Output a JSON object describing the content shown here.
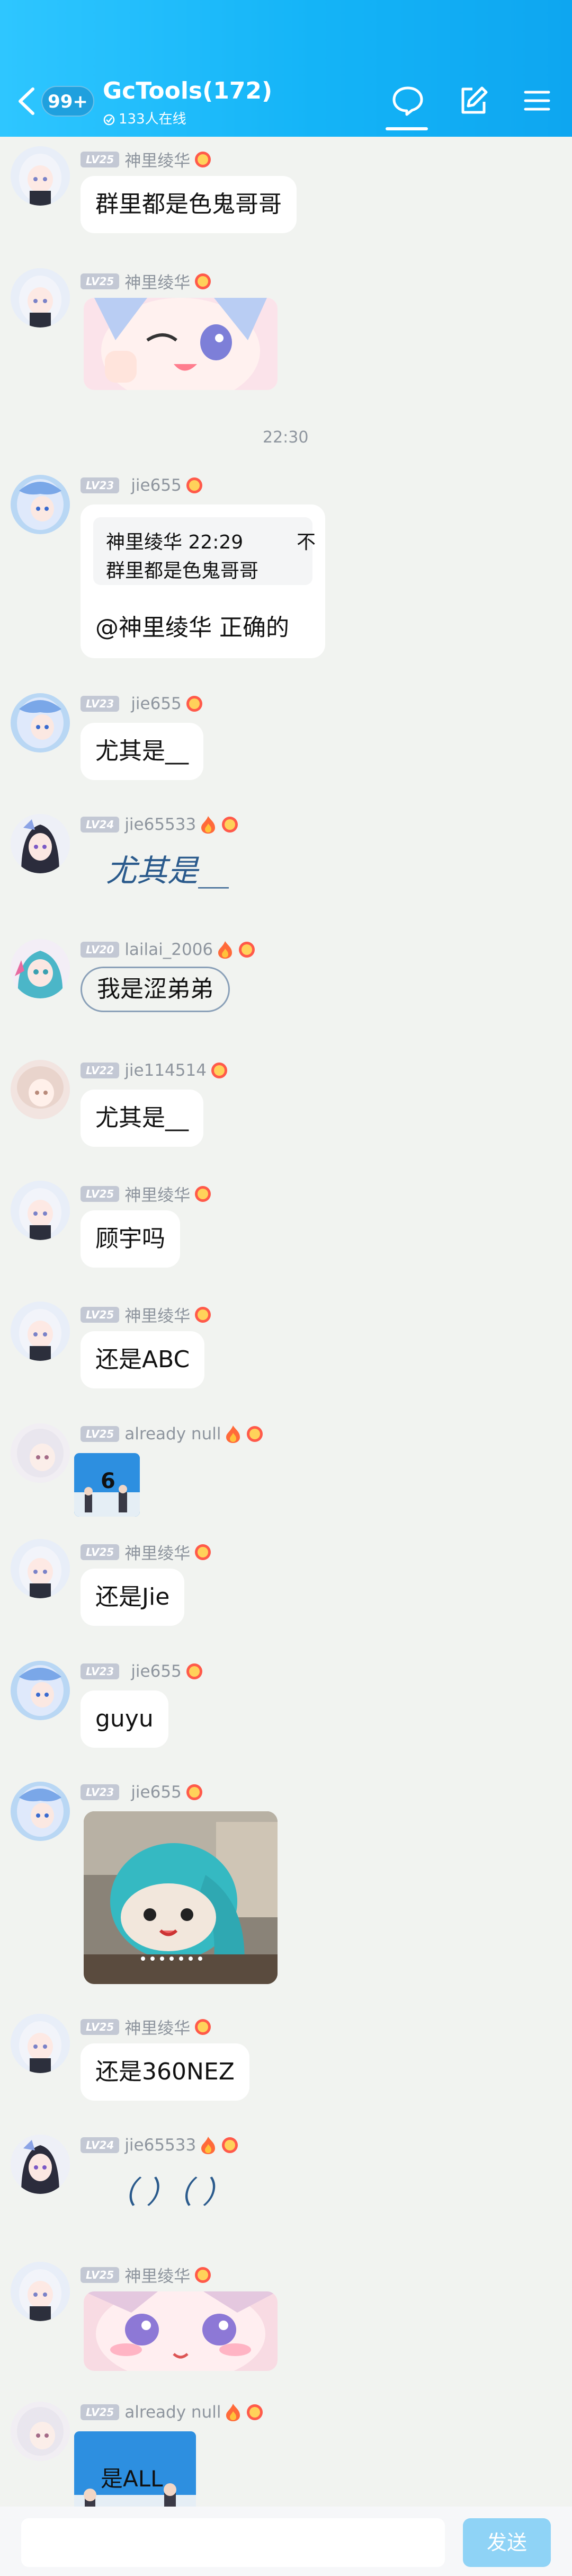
{
  "header": {
    "unread_badge": "99+",
    "title": "GcTools(172)",
    "online": "133人在线"
  },
  "messages": [
    {
      "level": "LV25",
      "nick": "神里绫华",
      "text": "群里都是色鬼哥哥"
    },
    {
      "level": "LV25",
      "nick": "神里绫华"
    },
    {
      "level": "LV23",
      "nick": "jie655",
      "quote_name": "神里绫华",
      "quote_time": "22:29",
      "quote_x": "不",
      "quote_text": "群里都是色鬼哥哥",
      "text": "@神里绫华 正确的"
    },
    {
      "level": "LV23",
      "nick": "jie655",
      "text": "尤其是__"
    },
    {
      "level": "LV24",
      "nick": "jie65533",
      "text": "尤其是__"
    },
    {
      "level": "LV20",
      "nick": "lailai_2006",
      "text": "我是涩弟弟"
    },
    {
      "level": "LV22",
      "nick": "jie114514",
      "text": "尤其是__"
    },
    {
      "level": "LV25",
      "nick": "神里绫华",
      "text": "顾宇吗"
    },
    {
      "level": "LV25",
      "nick": "神里绫华",
      "text": "还是ABC"
    },
    {
      "level": "LV25",
      "nick": "already null",
      "sticker_text": "6"
    },
    {
      "level": "LV25",
      "nick": "神里绫华",
      "text": "还是Jie"
    },
    {
      "level": "LV23",
      "nick": "jie655",
      "text": "guyu"
    },
    {
      "level": "LV23",
      "nick": "jie655"
    },
    {
      "level": "LV25",
      "nick": "神里绫华",
      "text": "还是360NEZ"
    },
    {
      "level": "LV24",
      "nick": "jie65533",
      "text": "（ ）（ ）"
    },
    {
      "level": "LV25",
      "nick": "神里绫华"
    },
    {
      "level": "LV25",
      "nick": "already null",
      "sticker_text": "是ALL"
    }
  ],
  "timestamp": "22:30",
  "composer": {
    "placeholder": "",
    "send_label": "发送"
  },
  "colors": {
    "header_start": "#2ec6ff",
    "header_end": "#0ea6f0",
    "background": "#f1f3f0",
    "send_button": "#8fd3f6"
  }
}
